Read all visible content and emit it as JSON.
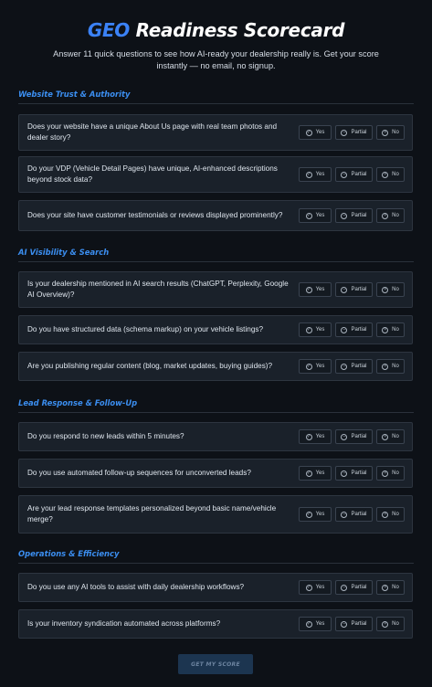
{
  "header": {
    "title_accent": "GEO",
    "title_rest": " Readiness Scorecard",
    "intro": "Answer 11 quick questions to see how AI-ready your dealership really is. Get your score instantly — no email, no signup."
  },
  "options": {
    "yes": "Yes",
    "partial": "Partial",
    "no": "No"
  },
  "sections": [
    {
      "title": "Website Trust & Authority",
      "questions": [
        "Does your website have a unique About Us page with real team photos and dealer story?",
        "Do your VDP (Vehicle Detail Pages) have unique, AI-enhanced descriptions beyond stock data?",
        "Does your site have customer testimonials or reviews displayed prominently?"
      ]
    },
    {
      "title": "AI Visibility & Search",
      "questions": [
        "Is your dealership mentioned in AI search results (ChatGPT, Perplexity, Google AI Overview)?",
        "Do you have structured data (schema markup) on your vehicle listings?",
        "Are you publishing regular content (blog, market updates, buying guides)?"
      ]
    },
    {
      "title": "Lead Response & Follow-Up",
      "questions": [
        "Do you respond to new leads within 5 minutes?",
        "Do you use automated follow-up sequences for unconverted leads?",
        "Are your lead response templates personalized beyond basic name/vehicle merge?"
      ]
    },
    {
      "title": "Operations & Efficiency",
      "questions": [
        "Do you use any AI tools to assist with daily dealership workflows?",
        "Is your inventory syndication automated across platforms?"
      ]
    }
  ],
  "cta": {
    "label": "GET MY SCORE"
  },
  "icons": {
    "yes": "check-icon",
    "partial": "minus-icon",
    "no": "x-icon"
  },
  "colors": {
    "accent": "#3b82f6",
    "background": "#0d1117",
    "card": "#1a212a"
  }
}
